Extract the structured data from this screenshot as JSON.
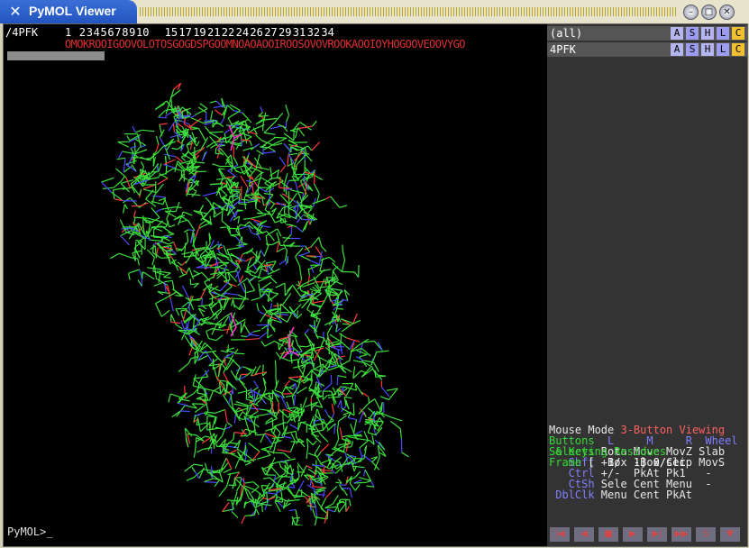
{
  "window": {
    "title": "PyMOL Viewer"
  },
  "sequence": {
    "object": "/4PFK",
    "numbers": [
      {
        "n": "1",
        "col": 0
      },
      {
        "n": "2",
        "col": 4
      },
      {
        "n": "3",
        "col": 6
      },
      {
        "n": "4",
        "col": 8
      },
      {
        "n": "5",
        "col": 10
      },
      {
        "n": "6",
        "col": 12
      },
      {
        "n": "7",
        "col": 14
      },
      {
        "n": "8",
        "col": 16
      },
      {
        "n": "9",
        "col": 18
      },
      {
        "n": "10",
        "col": 20
      },
      {
        "n": "15",
        "col": 28
      },
      {
        "n": "17",
        "col": 32
      },
      {
        "n": "19",
        "col": 36
      },
      {
        "n": "21",
        "col": 40
      },
      {
        "n": "22",
        "col": 44
      },
      {
        "n": "24",
        "col": 48
      },
      {
        "n": "26",
        "col": 52
      },
      {
        "n": "27",
        "col": 56
      },
      {
        "n": "29",
        "col": 60
      },
      {
        "n": "31",
        "col": 64
      },
      {
        "n": "32",
        "col": 68
      },
      {
        "n": "34",
        "col": 72
      }
    ],
    "residues": "OMOKROOIGOOVOLOTOSGOGDSPGOOMNOAOAOOIROOSOVOVROOKAOOIOYHOGOOVEOOVYGO"
  },
  "prompt": "PyMOL>_",
  "objects": [
    {
      "name": "(all)",
      "buttons": [
        "A",
        "S",
        "H",
        "L",
        "C"
      ]
    },
    {
      "name": "4PFK",
      "buttons": [
        "A",
        "S",
        "H",
        "L",
        "C"
      ]
    }
  ],
  "mouse": {
    "mode_label": "Mouse Mode",
    "mode_value": "3-Button Viewing",
    "lines": [
      {
        "a": "Buttons",
        "b": "  L     M     R  Wheel"
      },
      {
        "a": " & Keys",
        "b": " Rota Move MovZ Slab"
      },
      {
        "a": "   Shft",
        "b": " +Box -Box Clip MovS"
      },
      {
        "a": "   Ctrl",
        "b": " +/-  PkAt Pk1   -"
      },
      {
        "a": "   CtSh",
        "b": " Sele Cent Menu  -"
      },
      {
        "a": " DblClk",
        "b": " Menu Cent PkAt"
      }
    ],
    "selecting": "Selecting Residues",
    "frame_label": "Frame",
    "frame_value": "[  1/  1] 0/sec"
  },
  "controls": [
    "|◀",
    "◀",
    "■",
    "▶",
    "▶|",
    "▶▶",
    "S",
    "▼"
  ],
  "colors": {
    "accent": "#3a6fd6",
    "green": "#33ff33",
    "blue": "#7777ff",
    "red": "#ff5555"
  }
}
